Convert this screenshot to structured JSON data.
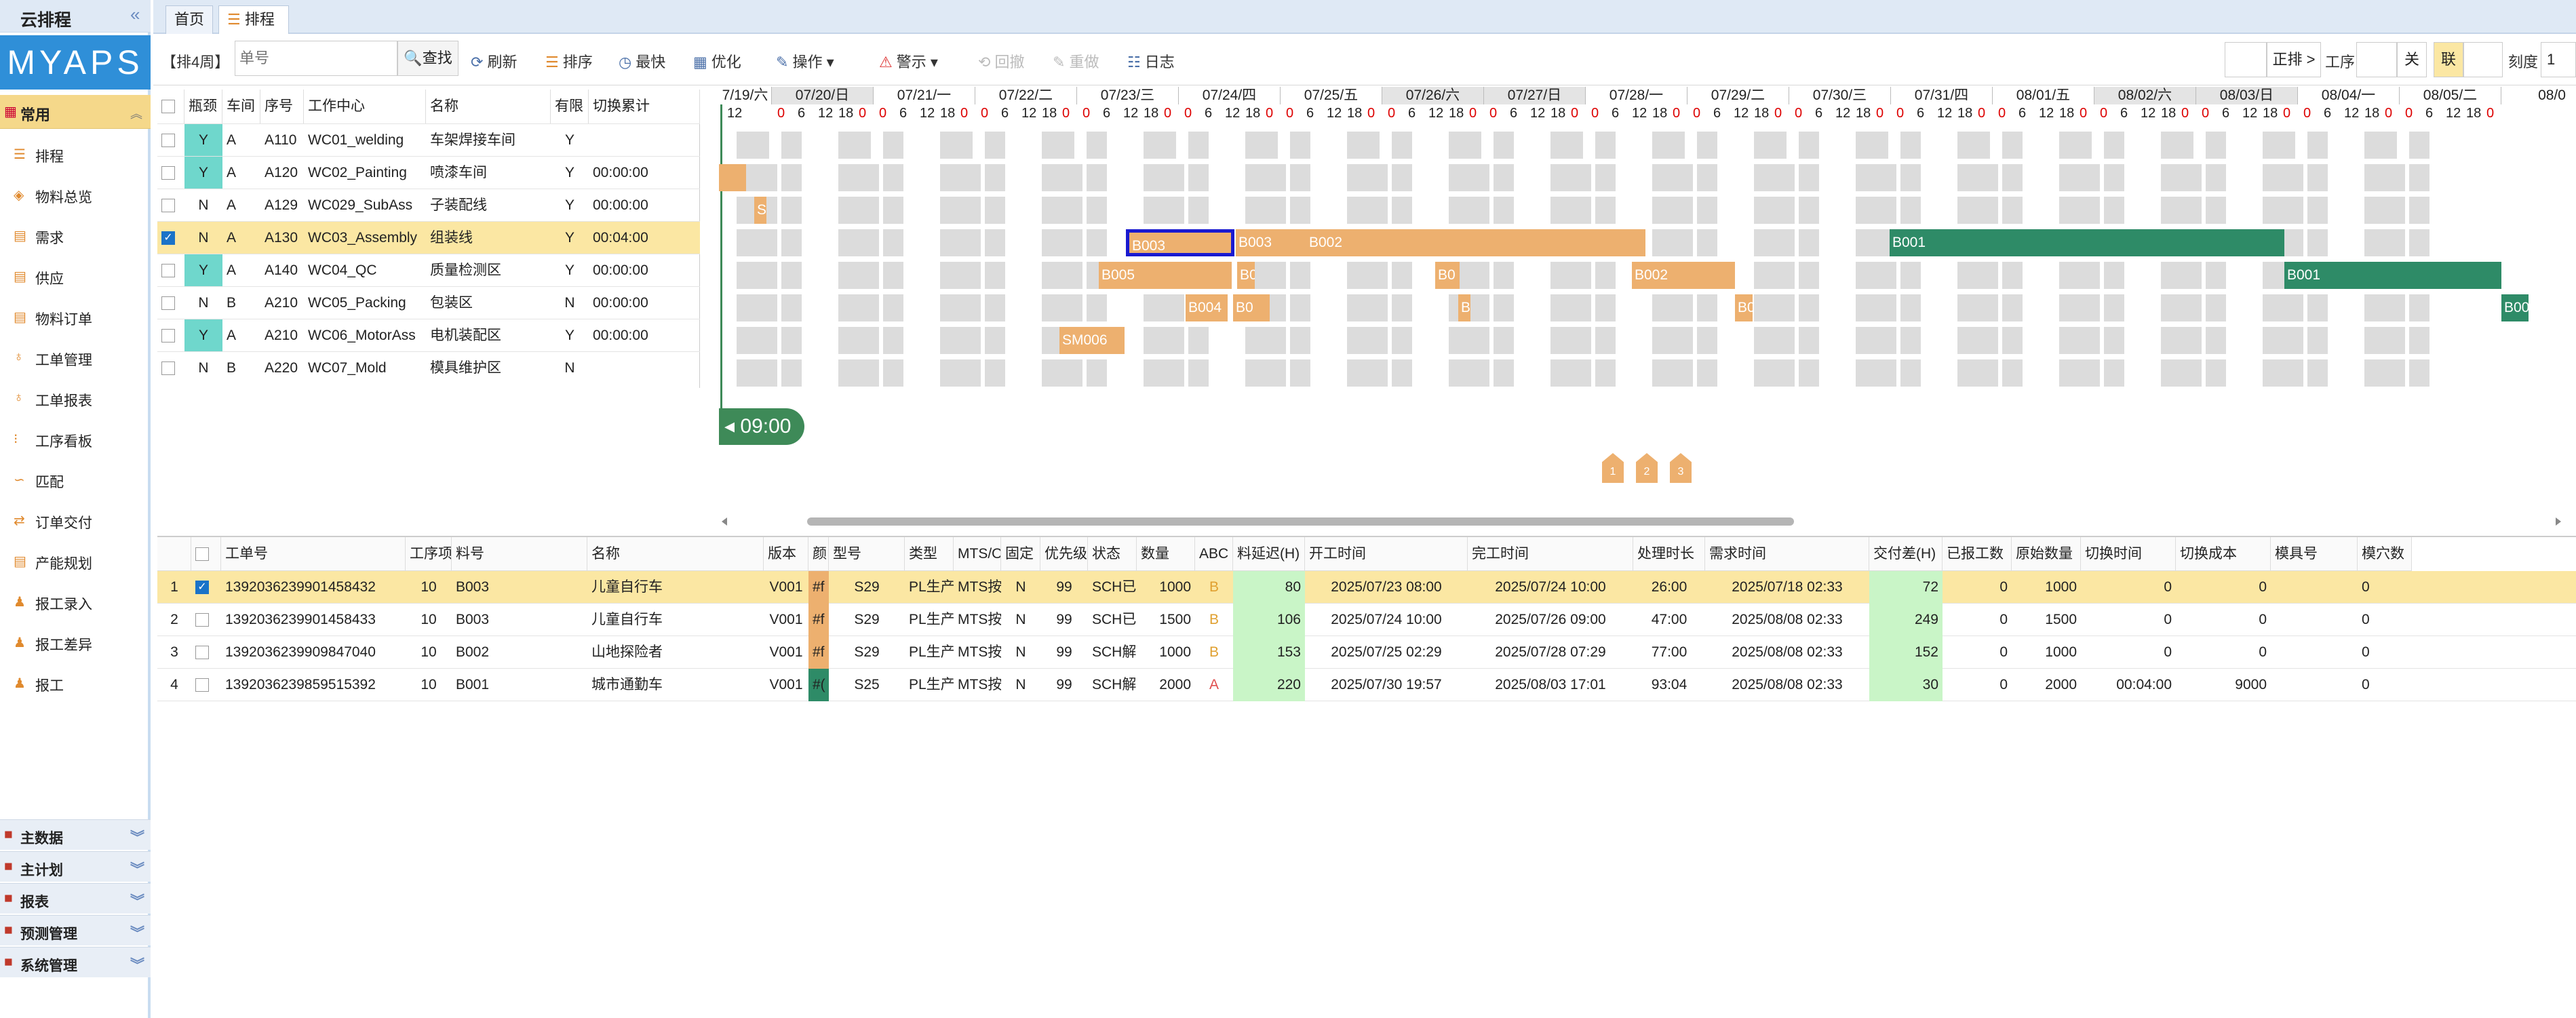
{
  "app": {
    "title": "云排程",
    "logo": "MYAPS",
    "collapse": "«"
  },
  "sidebar": {
    "group": "常用",
    "items": [
      {
        "label": "排程",
        "icon": "list-icon"
      },
      {
        "label": "物料总览",
        "icon": "cube-icon"
      },
      {
        "label": "需求",
        "icon": "doc-icon"
      },
      {
        "label": "供应",
        "icon": "doc-icon"
      },
      {
        "label": "物料订单",
        "icon": "doc-icon"
      },
      {
        "label": "工单管理",
        "icon": "medal-icon"
      },
      {
        "label": "工单报表",
        "icon": "medal-icon"
      },
      {
        "label": "工序看板",
        "icon": "board-icon"
      },
      {
        "label": "匹配",
        "icon": "link-icon"
      },
      {
        "label": "订单交付",
        "icon": "truck-icon"
      },
      {
        "label": "产能规划",
        "icon": "doc-icon"
      },
      {
        "label": "报工录入",
        "icon": "user-icon"
      },
      {
        "label": "报工差异",
        "icon": "user-icon"
      },
      {
        "label": "报工",
        "icon": "user-icon"
      }
    ],
    "bottom": [
      {
        "label": "主数据"
      },
      {
        "label": "主计划"
      },
      {
        "label": "报表"
      },
      {
        "label": "预测管理"
      },
      {
        "label": "系统管理"
      }
    ]
  },
  "tabs": [
    {
      "label": "首页"
    },
    {
      "label": "排程",
      "close": "×"
    }
  ],
  "toolbar": {
    "range": "【排4周】",
    "search_placeholder": "单号",
    "search": "查找",
    "refresh": "刷新",
    "sort": "排序",
    "fastest": "最快",
    "optimize": "优化",
    "operate": "操作",
    "warn": "警示",
    "undo": "回撤",
    "redo": "重做",
    "log": "日志",
    "right": {
      "forward": "正排 >",
      "proc": "工序",
      "off": "关",
      "link": "联",
      "scale_label": "刻度",
      "scale_value": "1"
    }
  },
  "resources": {
    "headers": [
      "瓶颈",
      "车间",
      "序号",
      "工作中心",
      "名称",
      "有限",
      "切换累计"
    ],
    "rows": [
      {
        "bn": "Y",
        "ws": "A",
        "seq": "A110",
        "wc": "WC01_welding",
        "name": "车架焊接车间",
        "lim": "Y",
        "sw": ""
      },
      {
        "bn": "Y",
        "ws": "A",
        "seq": "A120",
        "wc": "WC02_Painting",
        "name": "喷漆车间",
        "lim": "Y",
        "sw": "00:00:00"
      },
      {
        "bn": "N",
        "ws": "A",
        "seq": "A129",
        "wc": "WC029_SubAss",
        "name": "子装配线",
        "lim": "Y",
        "sw": "00:00:00"
      },
      {
        "bn": "N",
        "ws": "A",
        "seq": "A130",
        "wc": "WC03_Assembly",
        "name": "组装线",
        "lim": "Y",
        "sw": "00:04:00",
        "sel": true
      },
      {
        "bn": "Y",
        "ws": "A",
        "seq": "A140",
        "wc": "WC04_QC",
        "name": "质量检测区",
        "lim": "Y",
        "sw": "00:00:00"
      },
      {
        "bn": "N",
        "ws": "B",
        "seq": "A210",
        "wc": "WC05_Packing",
        "name": "包装区",
        "lim": "N",
        "sw": "00:00:00"
      },
      {
        "bn": "Y",
        "ws": "A",
        "seq": "A210",
        "wc": "WC06_MotorAss",
        "name": "电机装配区",
        "lim": "Y",
        "sw": "00:00:00"
      },
      {
        "bn": "N",
        "ws": "B",
        "seq": "A220",
        "wc": "WC07_Mold",
        "name": "模具维护区",
        "lim": "N",
        "sw": ""
      }
    ]
  },
  "gantt": {
    "days": [
      "7/19/六",
      "07/20/日",
      "07/21/一",
      "07/22/二",
      "07/23/三",
      "07/24/四",
      "07/25/五",
      "07/26/六",
      "07/27/日",
      "07/28/一",
      "07/29/二",
      "07/30/三",
      "07/31/四",
      "08/01/五",
      "08/02/六",
      "08/03/日",
      "08/04/一",
      "08/05/二",
      "08/0"
    ],
    "hours": [
      "12",
      "0",
      "6",
      "12",
      "18",
      "0"
    ],
    "time_label": "09:00",
    "pins": [
      "1",
      "2",
      "3"
    ],
    "bars": [
      {
        "label": "",
        "row": 1,
        "color": "o"
      },
      {
        "label": "S",
        "row": 2,
        "color": "o"
      },
      {
        "label": "B003",
        "row": 3,
        "color": "o",
        "selected": true
      },
      {
        "label": "B003",
        "row": 3,
        "color": "o"
      },
      {
        "label": "B002",
        "row": 3,
        "color": "o"
      },
      {
        "label": "B001",
        "row": 3,
        "color": "g"
      },
      {
        "label": "B005",
        "row": 4,
        "color": "o"
      },
      {
        "label": "B0",
        "row": 4,
        "color": "o"
      },
      {
        "label": "B0",
        "row": 4,
        "color": "o"
      },
      {
        "label": "B002",
        "row": 4,
        "color": "o"
      },
      {
        "label": "B001",
        "row": 4,
        "color": "g"
      },
      {
        "label": "B004",
        "row": 5,
        "color": "o"
      },
      {
        "label": "B0",
        "row": 5,
        "color": "o"
      },
      {
        "label": "B",
        "row": 5,
        "color": "o"
      },
      {
        "label": "B0",
        "row": 5,
        "color": "o"
      },
      {
        "label": "B00",
        "row": 5,
        "color": "g"
      },
      {
        "label": "SM006",
        "row": 6,
        "color": "o"
      }
    ]
  },
  "orders": {
    "headers": [
      "工单号",
      "工序项",
      "料号",
      "名称",
      "版本",
      "颜",
      "型号",
      "类型",
      "MTS/O",
      "固定",
      "优先级",
      "状态",
      "数量",
      "ABC",
      "料延迟(H)",
      "开工时间",
      "完工时间",
      "处理时长",
      "需求时间",
      "交付差(H)",
      "已报工数",
      "原始数量",
      "切换时间",
      "切换成本",
      "模具号",
      "模穴数"
    ],
    "rows": [
      {
        "n": "1",
        "id": "1392036239901458432",
        "op": "10",
        "item": "B003",
        "name": "儿童自行车",
        "ver": "V001",
        "color": "#f",
        "model": "S29",
        "type": "PL生产",
        "mts": "MTS按",
        "fix": "N",
        "pri": "99",
        "st": "SCH已",
        "qty": "1000",
        "abc": "B",
        "delay": "80",
        "start": "2025/07/23 08:00",
        "end": "2025/07/24 10:00",
        "dur": "26:00",
        "need": "2025/07/18 02:33",
        "diff": "72",
        "rep": "0",
        "orig": "1000",
        "swt": "0",
        "swc": "0",
        "mold": "",
        "cav": "0",
        "sel": true
      },
      {
        "n": "2",
        "id": "1392036239901458433",
        "op": "10",
        "item": "B003",
        "name": "儿童自行车",
        "ver": "V001",
        "color": "#f",
        "model": "S29",
        "type": "PL生产",
        "mts": "MTS按",
        "fix": "N",
        "pri": "99",
        "st": "SCH已",
        "qty": "1500",
        "abc": "B",
        "delay": "106",
        "start": "2025/07/24 10:00",
        "end": "2025/07/26 09:00",
        "dur": "47:00",
        "need": "2025/08/08 02:33",
        "diff": "249",
        "rep": "0",
        "orig": "1500",
        "swt": "0",
        "swc": "0",
        "mold": "",
        "cav": "0"
      },
      {
        "n": "3",
        "id": "1392036239909847040",
        "op": "10",
        "item": "B002",
        "name": "山地探险者",
        "ver": "V001",
        "color": "#f",
        "model": "S29",
        "type": "PL生产",
        "mts": "MTS按",
        "fix": "N",
        "pri": "99",
        "st": "SCH解",
        "qty": "1000",
        "abc": "B",
        "delay": "153",
        "start": "2025/07/25 02:29",
        "end": "2025/07/28 07:29",
        "dur": "77:00",
        "need": "2025/08/08 02:33",
        "diff": "152",
        "rep": "0",
        "orig": "1000",
        "swt": "0",
        "swc": "0",
        "mold": "",
        "cav": "0"
      },
      {
        "n": "4",
        "id": "1392036239859515392",
        "op": "10",
        "item": "B001",
        "name": "城市通勤车",
        "ver": "V001",
        "color": "#(",
        "model": "S25",
        "type": "PL生产",
        "mts": "MTS按",
        "fix": "N",
        "pri": "99",
        "st": "SCH解",
        "qty": "2000",
        "abc": "A",
        "delay": "220",
        "start": "2025/07/30 19:57",
        "end": "2025/08/03 17:01",
        "dur": "93:04",
        "need": "2025/08/08 02:33",
        "diff": "30",
        "rep": "0",
        "orig": "2000",
        "swt": "00:04:00",
        "swc": "9000",
        "mold": "",
        "cav": "0"
      }
    ]
  },
  "colors": {
    "accent": "#2f8fd8",
    "selected_row": "#fbe7a3",
    "bar_orange": "#edb06f",
    "bar_green": "#2e8b67",
    "teal": "#6fd7cc",
    "green_cell": "#c9f5c7"
  }
}
